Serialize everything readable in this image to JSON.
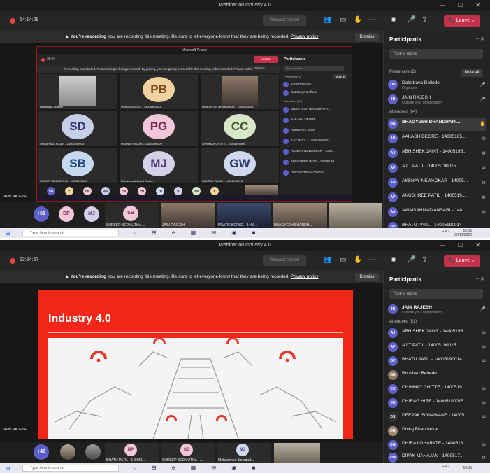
{
  "shot1": {
    "window_title": "Webinar on Industry 4.0",
    "timer": "14:14:28",
    "request_control": "Request control",
    "leave_label": "Leave",
    "recording_banner": {
      "bold": "You're recording",
      "text": "You are recording this meeting. Be sure to let everyone know that they are being recorded.",
      "link": "Privacy policy",
      "dismiss": "Dismiss"
    },
    "panel": {
      "title": "Participants",
      "search_placeholder": "Type a name",
      "presenters_label": "Presenters (2)",
      "mute_all": "Mute all",
      "presenters": [
        {
          "initials": "DD",
          "name": "Dattatraya Dollode",
          "sub": "Organizer"
        },
        {
          "initials": "JR",
          "name": "JAIN RAJESH",
          "sub": "Outside your organization"
        }
      ],
      "attendees_label": "Attendees (64)",
      "attendees": [
        {
          "initials": "BB",
          "name": "BHAGYESH BHANDHARI..."
        },
        {
          "initials": "AD",
          "name": "AAKASH DEORE - 14005185..."
        },
        {
          "initials": "AJ",
          "name": "ABHISHEK JAIN7 - 14005195..."
        },
        {
          "initials": "AP",
          "name": "AJIT PATIL - 14005190015"
        },
        {
          "initials": "AN",
          "name": "AKSHAY NEWADKAR - 14005..."
        },
        {
          "initials": "AP",
          "name": "ANUSHREE PATIL - 1400519..."
        },
        {
          "initials": "AA",
          "name": "AWAISAHMAD ANSARI - 140..."
        },
        {
          "initials": "BP",
          "name": "BHATU PATIL - 14005190014"
        }
      ]
    },
    "strip": {
      "more": "+61",
      "bubbles": [
        "BP",
        "MJ",
        "SB"
      ],
      "labels": [
        "SUDEEP BEDMUTHA ...",
        "JAIN RAJESH",
        "PRATIK BORSE - 1400...",
        "BHAGYESH BHANDH..."
      ]
    },
    "presenter_tag": "JAIN RAJESH",
    "nested": {
      "title": "Microsoft Teams",
      "timer": "25:24",
      "leave_label": "Leave",
      "banner": "Recording has started. This meeting is being recorded. By joining, you are giving consent for this meeting to be recorded. Privacy policy",
      "dismiss": "Dismiss",
      "tiles": [
        {
          "initials": "",
          "name": "Dattatraya Dollode",
          "color": "#e0e0e0"
        },
        {
          "initials": "PB",
          "name": "PRATIK BORSE - 14005190021",
          "color": "#f3d2a2"
        },
        {
          "initials": "",
          "name": "BHAGYESH BHANDHARI - 14005190007",
          "color": "#e0e0e0"
        },
        {
          "initials": "SD",
          "name": "SHUBHAM DALAVI - 14005190033",
          "color": "#c7cee8"
        },
        {
          "initials": "PG",
          "name": "PRANAV GUJAR - 14005190020",
          "color": "#f0c6d8"
        },
        {
          "initials": "CC",
          "name": "CHINMAY CHITTE - 14005190009",
          "color": "#d9e6c8"
        },
        {
          "initials": "SB",
          "name": "SUDEEP BEDMUTHA - 14005190036",
          "color": "#c7d9ef"
        },
        {
          "initials": "MJ",
          "name": "Mohammed Juned Shaikh",
          "color": "#d6cfe8"
        },
        {
          "initials": "GW",
          "name": "GAURAV WAGH - 14005190015",
          "color": "#d0d8ee"
        }
      ],
      "strip_bubbles": [
        "+46",
        "P",
        "PN",
        "AB",
        "PM",
        "PM",
        "YB",
        "D",
        "SN",
        "P"
      ],
      "panel_title": "Participants",
      "panel_search": "Type a name",
      "panel_presenters": "Presenters (2)",
      "panel_mute_all": "Mute all",
      "panel_rows": [
        "JAIN RAJESH",
        "Dattatraya Dollode",
        "BHAGYESH BHANDHARI...",
        "AAKASH DEORE",
        "ABHISHEK JAIN",
        "AJIT PATIL - 14005190015",
        "AKSHAY NEWADKAR - 1400...",
        "ANUSHREE PATIL - 14005190...",
        "AWAISAHMAD ANSARI"
      ],
      "panel_attendees": "Attendees (44)"
    },
    "taskbar": {
      "search": "Type here to search",
      "tray": "ENG",
      "time": "10:55",
      "date": "06/11/2020"
    }
  },
  "shot2": {
    "window_title": "Webinar on Industry 4.0",
    "timer": "13:54:57",
    "request_control": "Request control",
    "leave_label": "Leave",
    "recording_banner": {
      "bold": "You're recording",
      "text": "You are recording this meeting. Be sure to let everyone know that they are being recorded.",
      "link": "Privacy policy",
      "dismiss": "Dismiss"
    },
    "slide_title": "Industry 4.0",
    "presenter_tag": "JAIN RAJESH",
    "panel": {
      "title": "Participants",
      "search_placeholder": "Type a name",
      "presenters": [
        {
          "initials": "JR",
          "name": "JAIN RAJESH",
          "sub": "Outside your organization"
        }
      ],
      "attendees_label": "Attendees (51)",
      "attendees": [
        {
          "initials": "AJ",
          "name": "ABHISHEK JAIN7 - 14005195..."
        },
        {
          "initials": "AP",
          "name": "AJIT PATIL - 14005190015"
        },
        {
          "initials": "BP",
          "name": "BHATU PATIL - 14005190014"
        },
        {
          "initials": "BB",
          "name": "Bhushan Behede"
        },
        {
          "initials": "CC",
          "name": "CHINMAY CHITTE - 1400519..."
        },
        {
          "initials": "CH",
          "name": "CHIRAG HIRE - 14005190015"
        },
        {
          "initials": "DS",
          "name": "DEEPAK SONAWANE - 14005..."
        },
        {
          "initials": "DB",
          "name": "Dhiraj Bhandarkar"
        },
        {
          "initials": "DG",
          "name": "DHIRAJ GHARATE - 1400518..."
        },
        {
          "initials": "DM",
          "name": "DIPAK MAHAJAN - 1400517..."
        }
      ]
    },
    "strip": {
      "more": "+46",
      "bubbles": [
        "BP",
        "SB",
        "MJ"
      ],
      "labels": [
        "BHATU PATIL - 140051...",
        "SUDEEP BEDMUTHA - ...",
        "Mohammed Junedud..."
      ]
    },
    "taskbar": {
      "search": "Type here to search",
      "tray": "ENG",
      "time": "10:35"
    }
  },
  "colors": {
    "accent": "#5b5fc7",
    "leave": "#c4314b",
    "recording": "#e8414a",
    "slide_red": "#f22619"
  }
}
